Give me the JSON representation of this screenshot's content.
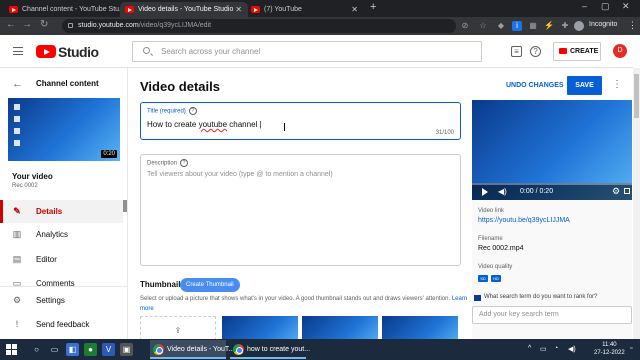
{
  "browser": {
    "tabs": [
      {
        "title": "Channel content - YouTube Stu..."
      },
      {
        "title": "Video details - YouTube Studio"
      },
      {
        "title": "(7) YouTube"
      }
    ],
    "url_host": "studio.youtube.com",
    "url_path": "/video/q39ycLIJMA/edit",
    "profile_label": "Incognito"
  },
  "header": {
    "logo_text": "Studio",
    "search_placeholder": "Search across your channel",
    "create_label": "CREATE",
    "avatar_initial": "D"
  },
  "sidebar": {
    "section_title": "Channel content",
    "thumb_duration": "0:20",
    "your_video_label": "Your video",
    "video_file": "Rec 0002",
    "items": [
      {
        "label": "Details",
        "icon": "pencil-icon",
        "glyph": "✎",
        "active": true
      },
      {
        "label": "Analytics",
        "icon": "analytics-icon",
        "glyph": "▥",
        "active": false
      },
      {
        "label": "Editor",
        "icon": "film-icon",
        "glyph": "▤",
        "active": false
      },
      {
        "label": "Comments",
        "icon": "comment-icon",
        "glyph": "▭",
        "active": false
      }
    ],
    "footer_items": [
      {
        "label": "Settings",
        "icon": "gear-icon",
        "glyph": "⚙"
      },
      {
        "label": "Send feedback",
        "icon": "feedback-icon",
        "glyph": "!"
      }
    ]
  },
  "main": {
    "page_title": "Video details",
    "undo_label": "UNDO CHANGES",
    "save_label": "SAVE",
    "title_field": {
      "label": "Title (required)",
      "value_before": "How to create ",
      "value_misspelled": "youtube",
      "value_after": " channel |",
      "counter": "31/100"
    },
    "description_field": {
      "label": "Description",
      "placeholder": "Tell viewers about your video (type @ to mention a channel)"
    },
    "thumbnail": {
      "heading": "Thumbnail",
      "create_label": "Create Thumbnail",
      "description": "Select or upload a picture that shows what's in your video. A good thumbnail stands out and draws viewers' attention.",
      "learn_more": "Learn more"
    }
  },
  "right_panel": {
    "player_time": "0:00 / 0:20",
    "video_link_label": "Video link",
    "video_link": "https://youtu.be/q39ycLIJJMA",
    "filename_label": "Filename",
    "filename": "Rec 0002.mp4",
    "quality_label": "Video quality",
    "quality_badges": [
      "SD",
      "HD"
    ],
    "seo_question": "What search term do you want to rank for?",
    "seo_placeholder": "Add your key search term"
  },
  "taskbar": {
    "items": [
      {
        "title": "Video details - YouT..."
      },
      {
        "title": "how to create yout..."
      }
    ],
    "time": "11:40",
    "date": "27-12-2022"
  },
  "colors": {
    "accent_blue": "#065fd4",
    "active_red": "#cc0000",
    "brand_red": "#ff0000"
  }
}
